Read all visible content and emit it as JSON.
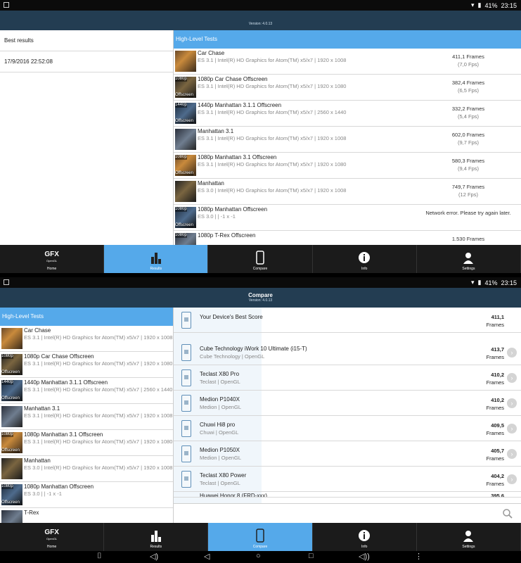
{
  "top": {
    "status": {
      "battery": "41%",
      "time": "23:15"
    },
    "version": "Version: 4.0.13",
    "left_header": "Best results",
    "result_date": "17/9/2016 22:52:08",
    "right_header": "High-Level Tests",
    "tests": [
      {
        "name": "Car Chase",
        "desc": "ES 3.1 | Intel(R) HD Graphics for Atom(TM) x5/x7 | 1920 x 1008",
        "score": "411,1 Frames",
        "fps": "(7,0 Fps)",
        "tag_top": "",
        "tag_bot": ""
      },
      {
        "name": "1080p Car Chase Offscreen",
        "desc": "ES 3.1 | Intel(R) HD Graphics for Atom(TM) x5/x7 | 1920 x 1080",
        "score": "382,4 Frames",
        "fps": "(6,5 Fps)",
        "tag_top": "1080p",
        "tag_bot": "Offscreen"
      },
      {
        "name": "1440p Manhattan 3.1.1 Offscreen",
        "desc": "ES 3.1 | Intel(R) HD Graphics for Atom(TM) x5/x7 | 2560 x 1440",
        "score": "332,2 Frames",
        "fps": "(5,4 Fps)",
        "tag_top": "1440p",
        "tag_bot": "Offscreen"
      },
      {
        "name": "Manhattan 3.1",
        "desc": "ES 3.1 | Intel(R) HD Graphics for Atom(TM) x5/x7 | 1920 x 1008",
        "score": "602,0 Frames",
        "fps": "(9,7 Fps)",
        "tag_top": "",
        "tag_bot": ""
      },
      {
        "name": "1080p Manhattan 3.1 Offscreen",
        "desc": "ES 3.1 | Intel(R) HD Graphics for Atom(TM) x5/x7 | 1920 x 1080",
        "score": "580,3 Frames",
        "fps": "(9,4 Fps)",
        "tag_top": "1080p",
        "tag_bot": "Offscreen"
      },
      {
        "name": "Manhattan",
        "desc": "ES 3.0 | Intel(R) HD Graphics for Atom(TM) x5/x7 | 1920 x 1008",
        "score": "749,7 Frames",
        "fps": "(12 Fps)",
        "tag_top": "",
        "tag_bot": ""
      },
      {
        "name": "1080p Manhattan Offscreen",
        "desc": "ES 3.0 |  | -1 x -1",
        "score": "Network error. Please try again later.",
        "fps": "",
        "tag_top": "1080p",
        "tag_bot": "Offscreen"
      },
      {
        "name": "1080p T-Rex Offscreen",
        "desc": "",
        "score": "1.530 Frames",
        "fps": "",
        "tag_top": "1080p",
        "tag_bot": ""
      }
    ],
    "nav": [
      "Home",
      "Results",
      "Compare",
      "Info",
      "Settings"
    ]
  },
  "bottom": {
    "status": {
      "battery": "41%",
      "time": "23:15"
    },
    "title": "Compare",
    "version": "Version: 4.0.13",
    "left_header": "High-Level Tests",
    "tests": [
      {
        "name": "Car Chase",
        "desc": "ES 3.1 | Intel(R) HD Graphics for Atom(TM) x5/x7 | 1920 x 1008",
        "tag_top": "",
        "tag_bot": ""
      },
      {
        "name": "1080p Car Chase Offscreen",
        "desc": "ES 3.1 | Intel(R) HD Graphics for Atom(TM) x5/x7 | 1920 x 1080",
        "tag_top": "1080p",
        "tag_bot": "Offscreen"
      },
      {
        "name": "1440p Manhattan 3.1.1 Offscreen",
        "desc": "ES 3.1 | Intel(R) HD Graphics for Atom(TM) x5/x7 | 2560 x 1440",
        "tag_top": "1440p",
        "tag_bot": "Offscreen"
      },
      {
        "name": "Manhattan 3.1",
        "desc": "ES 3.1 | Intel(R) HD Graphics for Atom(TM) x5/x7 | 1920 x 1008",
        "tag_top": "",
        "tag_bot": ""
      },
      {
        "name": "1080p Manhattan 3.1 Offscreen",
        "desc": "ES 3.1 | Intel(R) HD Graphics for Atom(TM) x5/x7 | 1920 x 1080",
        "tag_top": "1080p",
        "tag_bot": "Offscreen"
      },
      {
        "name": "Manhattan",
        "desc": "ES 3.0 | Intel(R) HD Graphics for Atom(TM) x5/x7 | 1920 x 1008",
        "tag_top": "",
        "tag_bot": ""
      },
      {
        "name": "1080p Manhattan Offscreen",
        "desc": "ES 3.0 |  | -1 x -1",
        "tag_top": "1080p",
        "tag_bot": "Offscreen"
      },
      {
        "name": "T-Rex",
        "desc": "",
        "tag_top": "",
        "tag_bot": ""
      }
    ],
    "best": {
      "label": "Your Device's Best Score",
      "score": "411,1",
      "unit": "Frames"
    },
    "devices": [
      {
        "name": "Cube Technology iWork 10 Ultimate (i15-T)",
        "sub": "Cube Technology | OpenGL",
        "score": "413,7",
        "unit": "Frames"
      },
      {
        "name": "Teclast X80 Pro",
        "sub": "Teclast | OpenGL",
        "score": "410,2",
        "unit": "Frames"
      },
      {
        "name": "Medion P1040X",
        "sub": "Medion | OpenGL",
        "score": "410,2",
        "unit": "Frames"
      },
      {
        "name": "Chuwi Hi8 pro",
        "sub": "Chuwi | OpenGL",
        "score": "409,5",
        "unit": "Frames"
      },
      {
        "name": "Medion P1050X",
        "sub": "Medion | OpenGL",
        "score": "405,7",
        "unit": "Frames"
      },
      {
        "name": "Teclast X80 Power",
        "sub": "Teclast | OpenGL",
        "score": "404,2",
        "unit": "Frames"
      }
    ],
    "partial_device": {
      "name": "Huawei Honor 8 (FRD-xxx)",
      "score": "395,6"
    },
    "nav": [
      "Home",
      "Results",
      "Compare",
      "Info",
      "Settings"
    ]
  },
  "icons": {
    "gfx_logo": "GFX",
    "gfx_sub": "OpenGL"
  },
  "colors": {
    "accent": "#55a9ea",
    "titlebar": "#233d52",
    "nav": "#1b1b1b"
  }
}
